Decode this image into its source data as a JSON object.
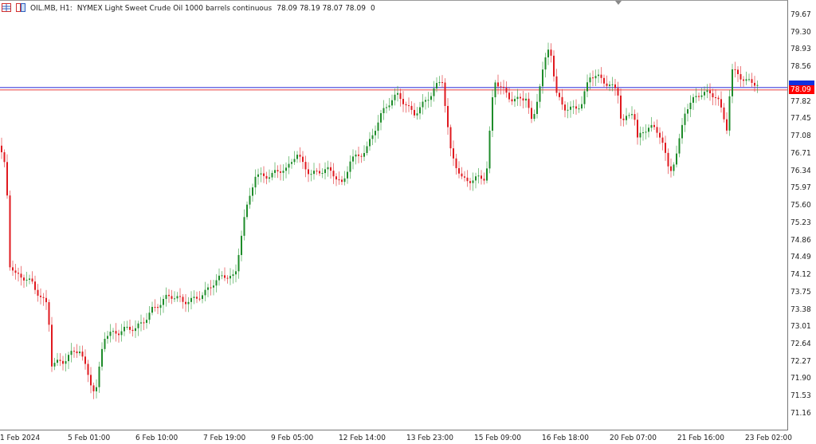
{
  "chart": {
    "symbol": "OIL.MB, H1:",
    "description": "NYMEX Light Sweet Crude Oil 1000 barrels continuous",
    "ohlc": "78.09 78.19 78.07 78.09",
    "volume": "0"
  },
  "price_axis": {
    "labels": [
      "79.67",
      "79.30",
      "78.93",
      "78.56",
      "77.82",
      "77.45",
      "77.08",
      "76.71",
      "76.34",
      "75.97",
      "75.60",
      "75.23",
      "74.86",
      "74.49",
      "74.12",
      "73.75",
      "73.38",
      "73.01",
      "72.64",
      "72.27",
      "71.90",
      "71.53",
      "71.16"
    ],
    "current_price": "78.09"
  },
  "time_axis": {
    "labels": [
      "1 Feb 2024",
      "5 Feb 01:00",
      "6 Feb 10:00",
      "7 Feb 19:00",
      "9 Feb 05:00",
      "12 Feb 14:00",
      "13 Feb 23:00",
      "15 Feb 09:00",
      "16 Feb 18:00",
      "20 Feb 07:00",
      "21 Feb 16:00",
      "23 Feb 02:00"
    ]
  }
}
